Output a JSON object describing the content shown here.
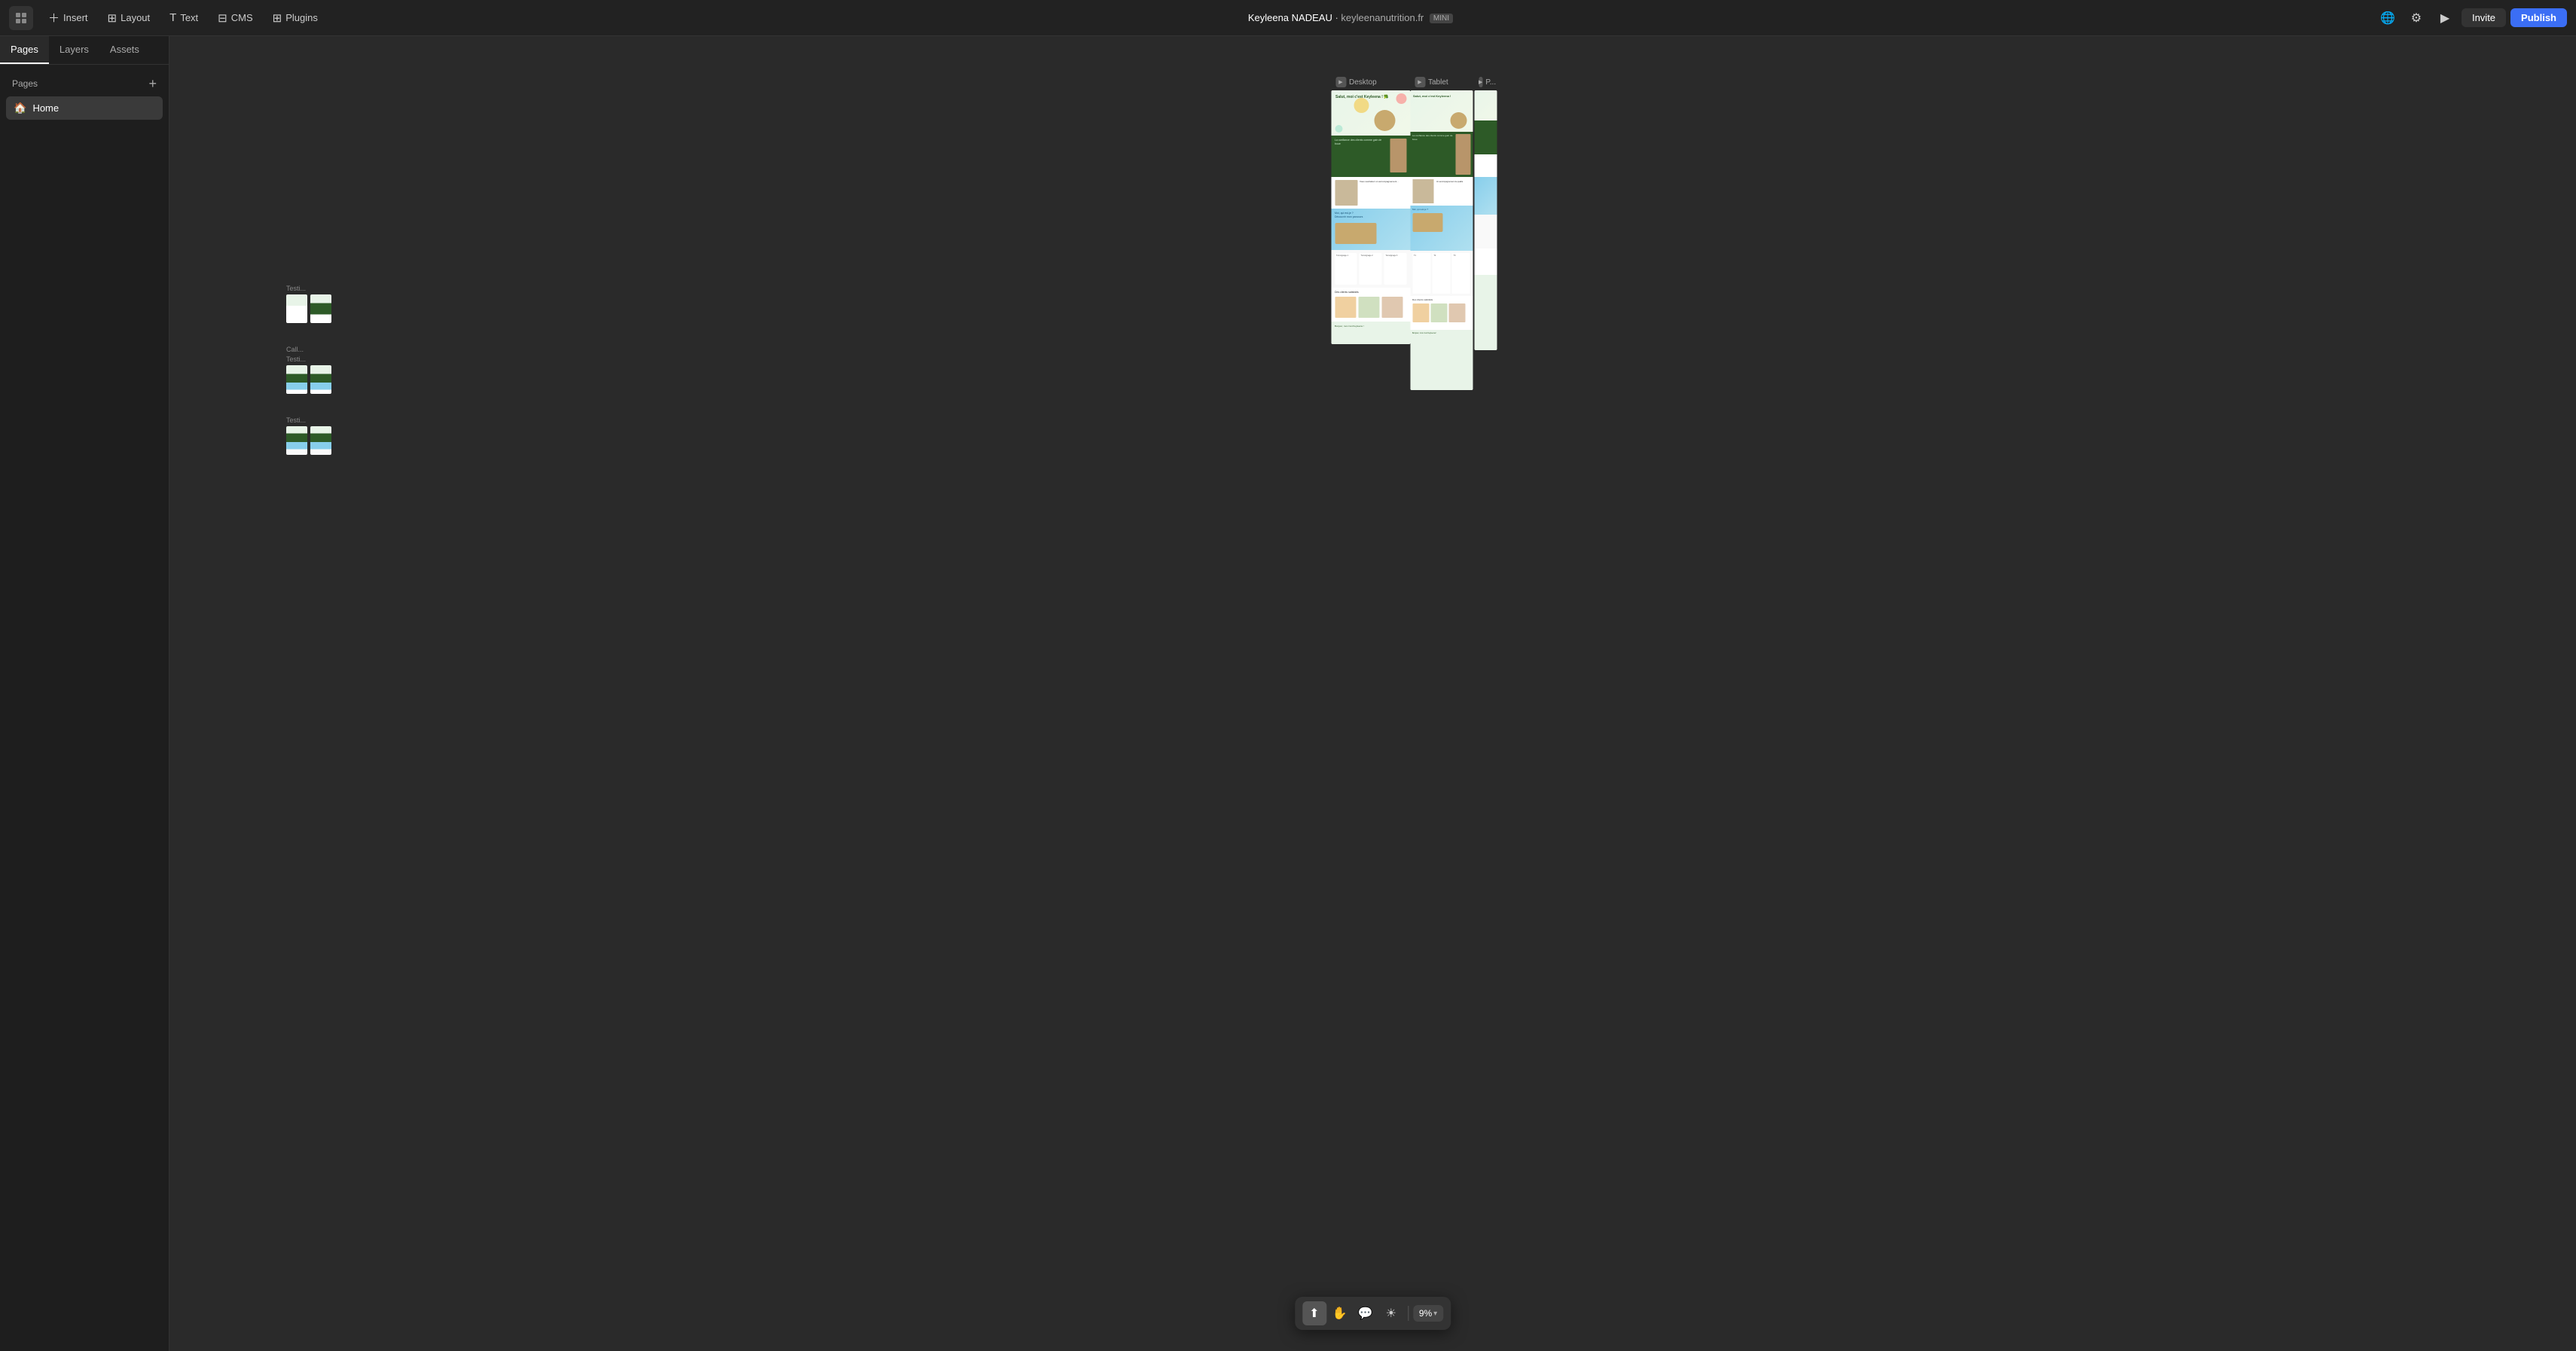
{
  "topbar": {
    "logo_icon": "◈",
    "insert_label": "Insert",
    "layout_label": "Layout",
    "text_label": "Text",
    "cms_label": "CMS",
    "plugins_label": "Plugins",
    "user_name": "Keyleena NADEAU",
    "separator": "·",
    "domain": "keyleenanutrition.fr",
    "badge": "MINI",
    "invite_label": "Invite",
    "publish_label": "Publish"
  },
  "sidebar": {
    "tabs": [
      {
        "label": "Pages",
        "active": true
      },
      {
        "label": "Layers",
        "active": false
      },
      {
        "label": "Assets",
        "active": false
      }
    ],
    "section_label": "Pages",
    "pages": [
      {
        "icon": "🏠",
        "label": "Home"
      }
    ]
  },
  "canvas": {
    "preview_columns": [
      {
        "label": "Desktop",
        "icon": "▶"
      },
      {
        "label": "Tablet",
        "icon": "▶"
      },
      {
        "label": "P...",
        "icon": "▶"
      }
    ],
    "small_groups": [
      {
        "label": "Testi...",
        "sub_label": "",
        "docs": 2
      },
      {
        "label": "Call...",
        "sub_label": "Testi...",
        "docs": 2
      },
      {
        "label": "Testi...",
        "sub_label": "",
        "docs": 2
      }
    ]
  },
  "toolbar": {
    "tools": [
      {
        "name": "cursor",
        "icon": "⬆",
        "active": true
      },
      {
        "name": "hand",
        "icon": "✋",
        "active": false
      },
      {
        "name": "comment",
        "icon": "💬",
        "active": false
      },
      {
        "name": "lightbulb",
        "icon": "☀",
        "active": false
      }
    ],
    "zoom_value": "9%",
    "zoom_arrow": "▾"
  }
}
